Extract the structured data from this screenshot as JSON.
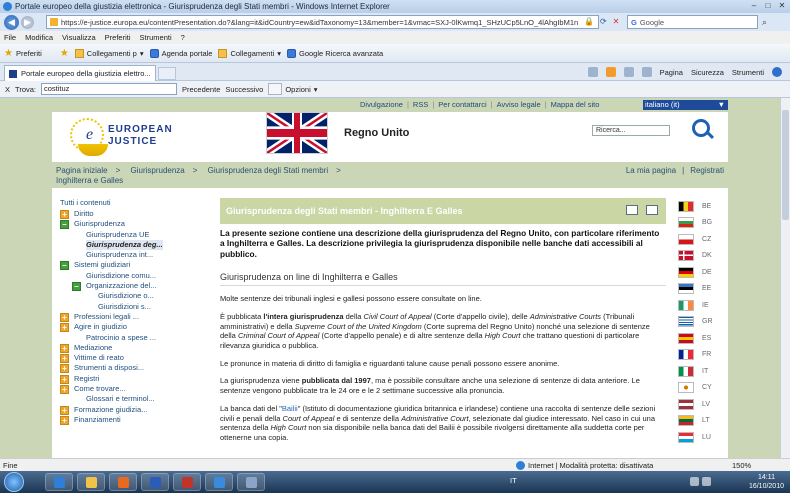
{
  "window": {
    "title": "Portale europeo della giustizia elettronica - Giurisprudenza degli Stati membri - Windows Internet Explorer"
  },
  "address_bar": {
    "url": "https://e-justice.europa.eu/contentPresentation.do?&lang=it&idCountry=ew&idTaxonomy=13&member=1&vmac=SXJ-0lKwmq1_SHzUCp5LnO_4lAhgIbM1n",
    "search_placeholder": "Google"
  },
  "menu": [
    "File",
    "Modifica",
    "Visualizza",
    "Preferiti",
    "Strumenti",
    "?"
  ],
  "favorites": {
    "label": "Preferiti",
    "items": [
      "Collegamenti p",
      "Agenda portale",
      "Collegamenti",
      "Google Ricerca avanzata"
    ]
  },
  "tab": {
    "label": "Portale europeo della giustizia elettro..."
  },
  "command_bar": [
    "Pagina",
    "Sicurezza",
    "Strumenti"
  ],
  "find_bar": {
    "close": "X",
    "label": "Trova:",
    "value": "costituz",
    "prev": "Precedente",
    "next": "Successivo",
    "options": "Opzioni"
  },
  "site": {
    "util_links": [
      "Divulgazione",
      "RSS",
      "Per contattarci",
      "Avviso legale",
      "Mappa del sito"
    ],
    "language": "italiano (it)",
    "logo_line1": "EUROPEAN",
    "logo_line2": "JUSTICE",
    "country": "Regno Unito",
    "search_label": "Ricerca...",
    "breadcrumb": [
      "Pagina iniziale",
      "Giurisprudenza",
      "Giurisprudenza degli Stati membri",
      "Inghilterra e Galles"
    ],
    "right_links": [
      "La mia pagina",
      "Registrati"
    ]
  },
  "left_nav": {
    "header": "Tutti i contenuti",
    "items": [
      {
        "label": "Diritto",
        "toggle": "+",
        "level": 0
      },
      {
        "label": "Giurisprudenza",
        "toggle": "-",
        "level": 0
      },
      {
        "label": "Giurisprudenza UE",
        "toggle": "",
        "level": 1
      },
      {
        "label": "Giurisprudenza deg...",
        "toggle": "",
        "level": 1,
        "selected": true
      },
      {
        "label": "Giurisprudenza int...",
        "toggle": "",
        "level": 1
      },
      {
        "label": "Sistemi giudiziari",
        "toggle": "-",
        "level": 0
      },
      {
        "label": "Giurisdizione comu...",
        "toggle": "",
        "level": 1
      },
      {
        "label": "Organizzazione del...",
        "toggle": "-",
        "level": 1
      },
      {
        "label": "Giurisdizione o...",
        "toggle": "",
        "level": 2
      },
      {
        "label": "Giurisdizioni s...",
        "toggle": "",
        "level": 2
      },
      {
        "label": "Professioni legali ...",
        "toggle": "+",
        "level": 0
      },
      {
        "label": "Agire in giudizio",
        "toggle": "+",
        "level": 0
      },
      {
        "label": "Patrocinio a spese ...",
        "toggle": "",
        "level": 1
      },
      {
        "label": "Mediazione",
        "toggle": "+",
        "level": 0
      },
      {
        "label": "Vittime di reato",
        "toggle": "+",
        "level": 0
      },
      {
        "label": "Strumenti a disposi...",
        "toggle": "+",
        "level": 0
      },
      {
        "label": "Registri",
        "toggle": "+",
        "level": 0
      },
      {
        "label": "Come trovare...",
        "toggle": "+",
        "level": 0
      },
      {
        "label": "Glossari e terminol...",
        "toggle": "",
        "level": 1
      },
      {
        "label": "Formazione giudizia...",
        "toggle": "+",
        "level": 0
      },
      {
        "label": "Finanziamenti",
        "toggle": "+",
        "level": 0
      }
    ]
  },
  "main": {
    "title": "Giurisprudenza degli Stati membri - Inghilterra E Galles",
    "intro": "La presente sezione contiene una descrizione della giurisprudenza del Regno Unito, con particolare riferimento a Inghilterra e Galles. La descrizione privilegia la giurisprudenza disponibile nelle banche dati accessibili al pubblico.",
    "subheading": "Giurisprudenza on line di Inghilterra e Galles",
    "p1": "Molte sentenze dei tribunali inglesi e gallesi possono essere consultate on line.",
    "p2": {
      "a": "È pubblicata ",
      "b": "l'intera giurisprudenza",
      "c": " della ",
      "d": "Civil Court of Appeal",
      "e": " (Corte d'appello civile), delle ",
      "f": "Administrative Courts",
      "g": " (Tribunali amministrativi) e della ",
      "h": "Supreme Court of the United Kingdom",
      "i": " (Corte suprema del Regno Unito) nonché una selezione di sentenze della ",
      "j": "Criminal Court of Appeal",
      "k": " (Corte d'appello penale) e di altre sentenze della ",
      "l": "High Court",
      "m": " che trattano questioni di particolare rilevanza giuridica o pubblica."
    },
    "p3": "Le pronunce in materia di diritto di famiglia e riguardanti talune cause penali possono essere anonime.",
    "p4": {
      "a": "La giurisprudenza viene ",
      "b": "pubblicata dal 1997",
      "c": ", ma è possibile consultare anche una selezione di sentenze di data anteriore. Le sentenze vengono pubblicate tra le 24 ore e le 2 settimane successive alla pronuncia."
    },
    "p5": {
      "a": "La banca dati del \"",
      "b": "Bailii",
      "c": "\" (Istituto di documentazione giuridica britannica e irlandese) contiene una raccolta di sentenze delle sezioni civili e penali della ",
      "d": "Court of Appeal",
      "e": " e di sentenze della ",
      "f": "Administrative Court",
      "g": ", selezionate dal giudice interessato. Nel caso in cui una sentenza della ",
      "h": "High Court",
      "i": " non sia disponibile nella banca dati del Bailii è possibile rivolgersi direttamente alla suddetta corte per ottenerne una copia."
    }
  },
  "country_flags": [
    {
      "code": "BE",
      "colors": [
        "#000000",
        "#f7d117",
        "#e32b2b"
      ],
      "orient": "v"
    },
    {
      "code": "BG",
      "colors": [
        "#ffffff",
        "#3c9b4a",
        "#d62612"
      ],
      "orient": "h"
    },
    {
      "code": "CZ",
      "colors": [
        "#ffffff",
        "#d7141a",
        "#11457e"
      ],
      "orient": "cz"
    },
    {
      "code": "DK",
      "colors": [
        "#c8102e",
        "#ffffff"
      ],
      "orient": "cross"
    },
    {
      "code": "DE",
      "colors": [
        "#000000",
        "#dd0000",
        "#ffce00"
      ],
      "orient": "h"
    },
    {
      "code": "EE",
      "colors": [
        "#3a75c4",
        "#000000",
        "#ffffff"
      ],
      "orient": "h"
    },
    {
      "code": "IE",
      "colors": [
        "#169b62",
        "#ffffff",
        "#ff883e"
      ],
      "orient": "v"
    },
    {
      "code": "GR",
      "colors": [
        "#0d5eaf",
        "#ffffff"
      ],
      "orient": "stripes"
    },
    {
      "code": "ES",
      "colors": [
        "#c60b1e",
        "#ffc400",
        "#c60b1e"
      ],
      "orient": "h"
    },
    {
      "code": "FR",
      "colors": [
        "#002395",
        "#ffffff",
        "#ed2939"
      ],
      "orient": "v"
    },
    {
      "code": "IT",
      "colors": [
        "#009246",
        "#ffffff",
        "#ce2b37"
      ],
      "orient": "v"
    },
    {
      "code": "CY",
      "colors": [
        "#ffffff",
        "#d57800"
      ],
      "orient": "solid"
    },
    {
      "code": "LV",
      "colors": [
        "#9e3039",
        "#ffffff",
        "#9e3039"
      ],
      "orient": "h"
    },
    {
      "code": "LT",
      "colors": [
        "#fdb913",
        "#006a44",
        "#c1272d"
      ],
      "orient": "h"
    },
    {
      "code": "LU",
      "colors": [
        "#ed2939",
        "#ffffff",
        "#00a1de"
      ],
      "orient": "h"
    }
  ],
  "status": {
    "left": "Fine",
    "zone": "Internet | Modalità protetta: disattivata",
    "zoom": "150%"
  },
  "taskbar": {
    "lang": "IT",
    "time": "14:11",
    "date": "16/10/2010"
  }
}
